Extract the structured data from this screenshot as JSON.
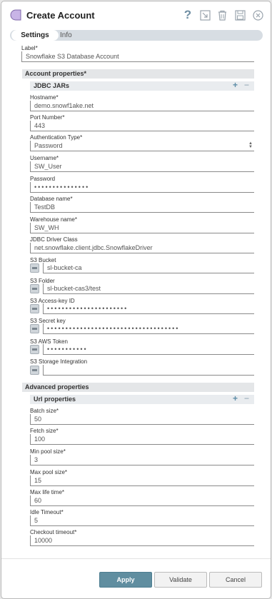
{
  "dialog": {
    "title": "Create Account"
  },
  "tabs": {
    "settings": "Settings",
    "info": "Info"
  },
  "fields": {
    "label": {
      "label": "Label*",
      "value": "Snowflake S3 Database Account"
    },
    "hostname": {
      "label": "Hostname*",
      "value": "demo.snowf1ake.net"
    },
    "port": {
      "label": "Port Number*",
      "value": "443"
    },
    "auth_type": {
      "label": "Authentication Type*",
      "value": "Password"
    },
    "username": {
      "label": "Username*",
      "value": "SW_User"
    },
    "password": {
      "label": "Password",
      "masked": "•••••••••••••••"
    },
    "database": {
      "label": "Database name*",
      "value": "TestDB"
    },
    "warehouse": {
      "label": "Warehouse name*",
      "value": "SW_WH"
    },
    "jdbc_driver": {
      "label": "JDBC Driver Class",
      "value": "net.snowflake.client.jdbc.SnowflakeDriver"
    },
    "s3_bucket": {
      "label": "S3 Bucket",
      "value": "sl-bucket-ca"
    },
    "s3_folder": {
      "label": "S3 Folder",
      "value": "sl-bucket-cas3/test"
    },
    "s3_access_key": {
      "label": "S3 Access-key ID",
      "masked": "••••••••••••••••••••••"
    },
    "s3_secret_key": {
      "label": "S3 Secret key",
      "masked": "••••••••••••••••••••••••••••••••••••"
    },
    "s3_token": {
      "label": "S3 AWS Token",
      "masked": "•••••••••••"
    },
    "s3_storage": {
      "label": "S3 Storage Integration",
      "value": ""
    },
    "batch_size": {
      "label": "Batch size*",
      "value": "50"
    },
    "fetch_size": {
      "label": "Fetch size*",
      "value": "100"
    },
    "min_pool": {
      "label": "Min pool size*",
      "value": "3"
    },
    "max_pool": {
      "label": "Max pool size*",
      "value": "15"
    },
    "max_life": {
      "label": "Max life time*",
      "value": "60"
    },
    "idle_timeout": {
      "label": "Idle Timeout*",
      "value": "5"
    },
    "checkout_timeout": {
      "label": "Checkout timeout*",
      "value": "10000"
    }
  },
  "sections": {
    "account": "Account properties*",
    "jdbc_jars": "JDBC JARs",
    "advanced": "Advanced properties",
    "url": "Url properties"
  },
  "buttons": {
    "apply": "Apply",
    "validate": "Validate",
    "cancel": "Cancel"
  },
  "icons": {
    "plus": "+",
    "minus": "−",
    "help": "?"
  },
  "colors": {
    "accent": "#608ea0",
    "app_icon": "#b7a0d8"
  }
}
